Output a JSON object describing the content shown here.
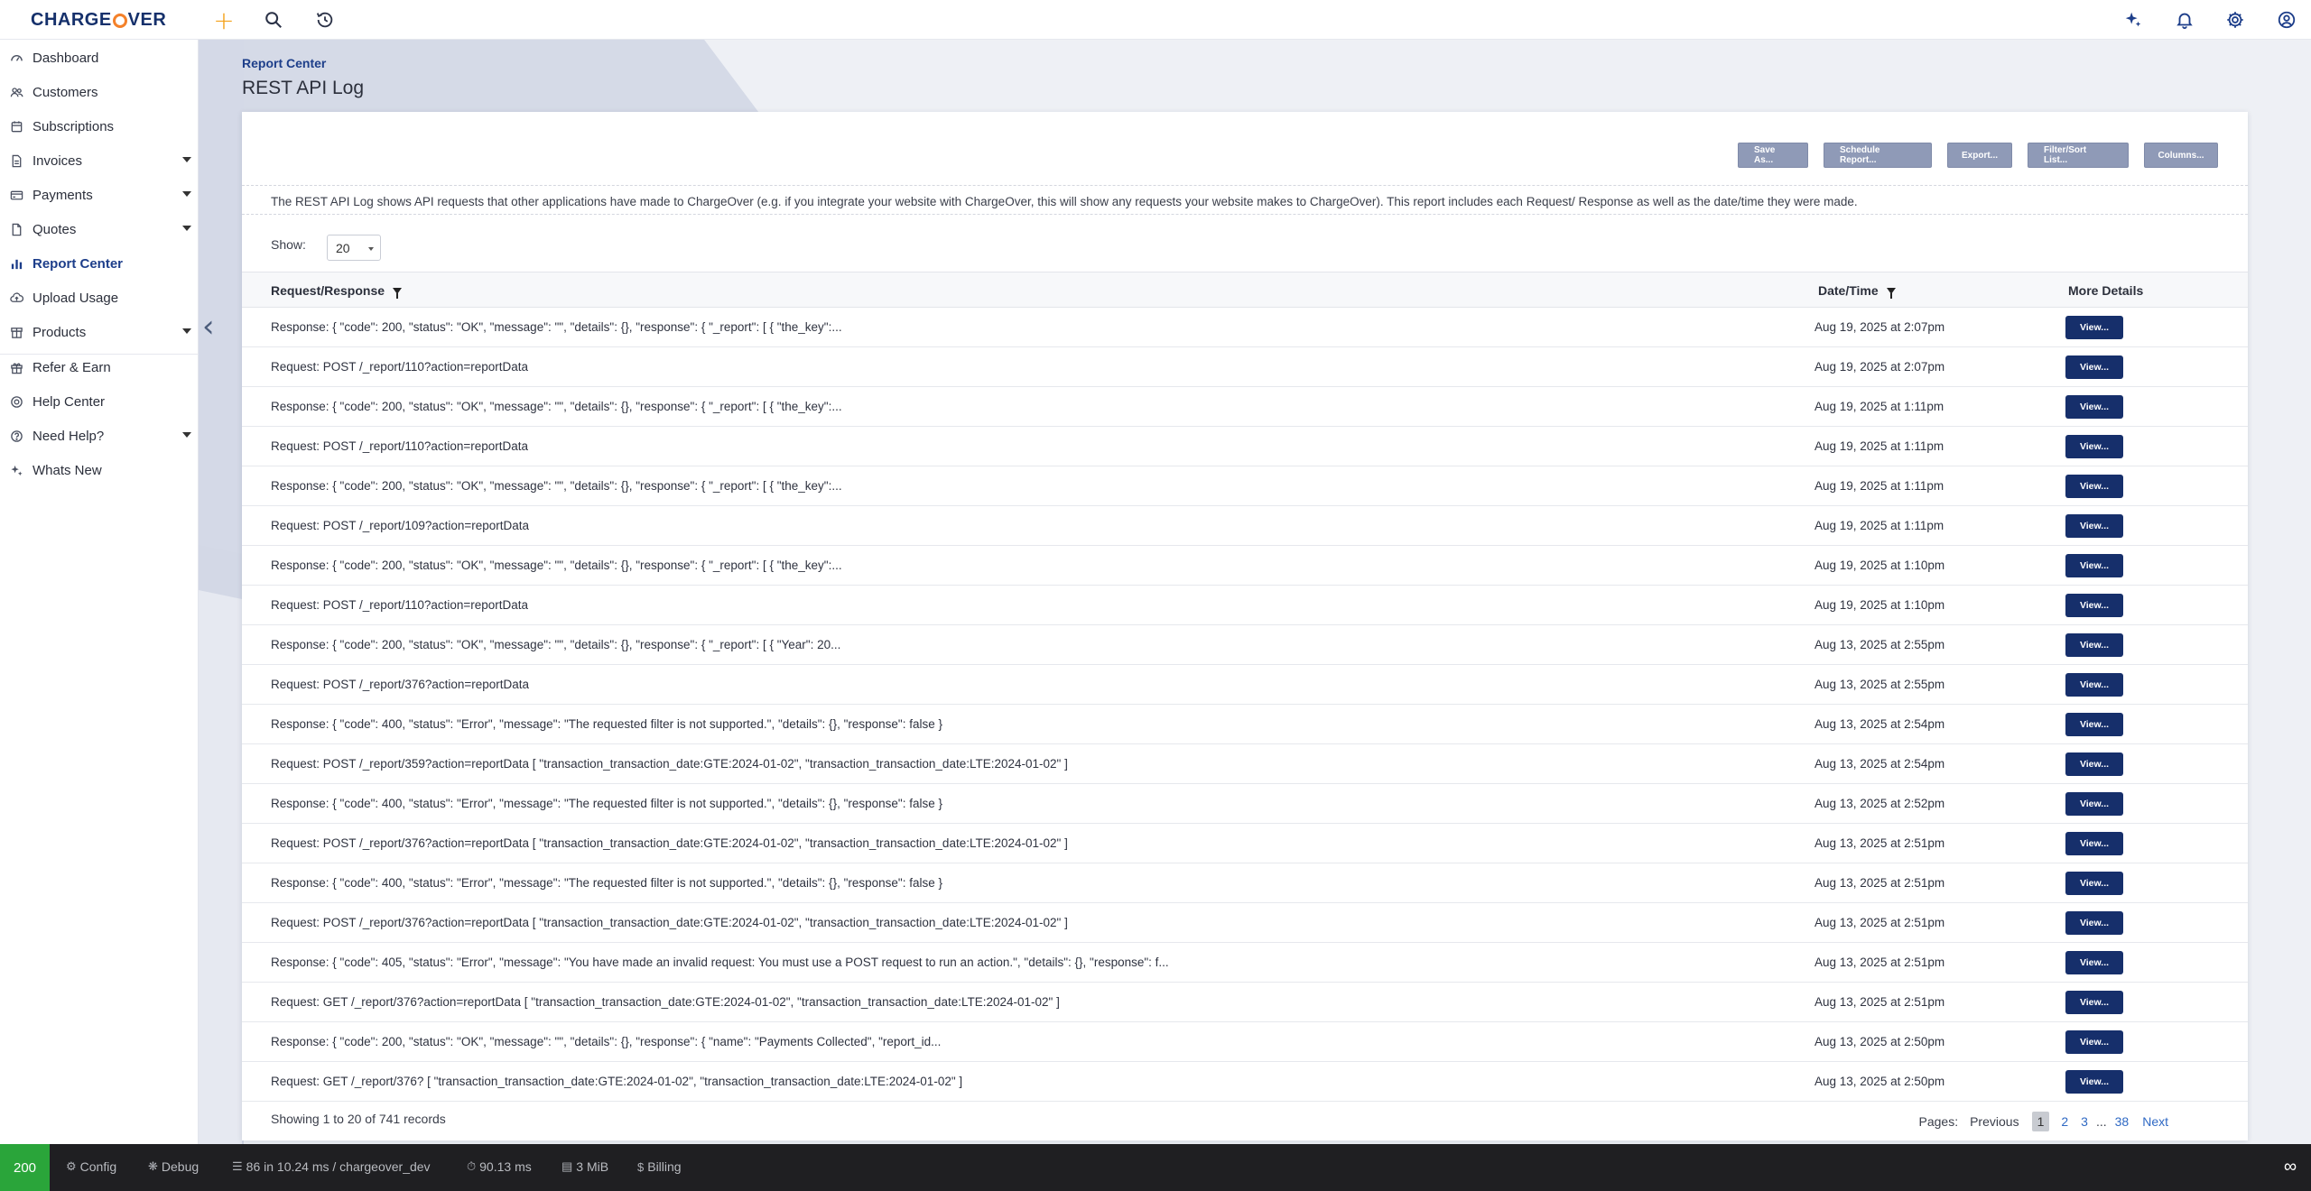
{
  "brand": {
    "prefix": "CHARGE",
    "suffix": "VER"
  },
  "nav": [
    {
      "label": "Dashboard"
    },
    {
      "label": "Customers"
    },
    {
      "label": "Subscriptions"
    },
    {
      "label": "Invoices"
    },
    {
      "label": "Payments"
    },
    {
      "label": "Quotes"
    },
    {
      "label": "Report Center"
    },
    {
      "label": "Upload Usage"
    },
    {
      "label": "Products"
    },
    {
      "label": "Refer & Earn"
    },
    {
      "label": "Help Center"
    },
    {
      "label": "Need Help?"
    },
    {
      "label": "Whats New"
    }
  ],
  "header": {
    "breadcrumb": "Report Center",
    "title": "REST API Log"
  },
  "toolbar": {
    "save_as": "Save As...",
    "schedule": "Schedule Report...",
    "export": "Export...",
    "filter_sort": "Filter/Sort List...",
    "columns": "Columns..."
  },
  "description": "The REST API Log shows API requests that other applications have made to ChargeOver (e.g. if you integrate your website with ChargeOver, this will show any requests your website makes to ChargeOver). This report includes each Request/ Response as well as the date/time they were made.",
  "show": {
    "label": "Show:",
    "value": "20"
  },
  "table": {
    "headers": {
      "request": "Request/Response",
      "date": "Date/Time",
      "more": "More Details"
    },
    "view_label": "View...",
    "rows": [
      {
        "req": "Response: { \"code\": 200, \"status\": \"OK\", \"message\": \"\", \"details\": {}, \"response\": { \"_report\": [ { \"the_key\":...",
        "date": "Aug 19, 2025 at 2:07pm"
      },
      {
        "req": "Request: POST /_report/110?action=reportData",
        "date": "Aug 19, 2025 at 2:07pm"
      },
      {
        "req": "Response: { \"code\": 200, \"status\": \"OK\", \"message\": \"\", \"details\": {}, \"response\": { \"_report\": [ { \"the_key\":...",
        "date": "Aug 19, 2025 at 1:11pm"
      },
      {
        "req": "Request: POST /_report/110?action=reportData",
        "date": "Aug 19, 2025 at 1:11pm"
      },
      {
        "req": "Response: { \"code\": 200, \"status\": \"OK\", \"message\": \"\", \"details\": {}, \"response\": { \"_report\": [ { \"the_key\":...",
        "date": "Aug 19, 2025 at 1:11pm"
      },
      {
        "req": "Request: POST /_report/109?action=reportData",
        "date": "Aug 19, 2025 at 1:11pm"
      },
      {
        "req": "Response: { \"code\": 200, \"status\": \"OK\", \"message\": \"\", \"details\": {}, \"response\": { \"_report\": [ { \"the_key\":...",
        "date": "Aug 19, 2025 at 1:10pm"
      },
      {
        "req": "Request: POST /_report/110?action=reportData",
        "date": "Aug 19, 2025 at 1:10pm"
      },
      {
        "req": "Response: { \"code\": 200, \"status\": \"OK\", \"message\": \"\", \"details\": {}, \"response\": { \"_report\": [ { \"Year\": 20...",
        "date": "Aug 13, 2025 at 2:55pm"
      },
      {
        "req": "Request: POST /_report/376?action=reportData",
        "date": "Aug 13, 2025 at 2:55pm"
      },
      {
        "req": "Response: { \"code\": 400, \"status\": \"Error\", \"message\": \"The requested filter is not supported.\", \"details\": {}, \"response\": false }",
        "date": "Aug 13, 2025 at 2:54pm"
      },
      {
        "req": "Request: POST /_report/359?action=reportData [ \"transaction_transaction_date:GTE:2024-01-02\", \"transaction_transaction_date:LTE:2024-01-02\" ]",
        "date": "Aug 13, 2025 at 2:54pm"
      },
      {
        "req": "Response: { \"code\": 400, \"status\": \"Error\", \"message\": \"The requested filter is not supported.\", \"details\": {}, \"response\": false }",
        "date": "Aug 13, 2025 at 2:52pm"
      },
      {
        "req": "Request: POST /_report/376?action=reportData [ \"transaction_transaction_date:GTE:2024-01-02\", \"transaction_transaction_date:LTE:2024-01-02\" ]",
        "date": "Aug 13, 2025 at 2:51pm"
      },
      {
        "req": "Response: { \"code\": 400, \"status\": \"Error\", \"message\": \"The requested filter is not supported.\", \"details\": {}, \"response\": false }",
        "date": "Aug 13, 2025 at 2:51pm"
      },
      {
        "req": "Request: POST /_report/376?action=reportData [ \"transaction_transaction_date:GTE:2024-01-02\", \"transaction_transaction_date:LTE:2024-01-02\" ]",
        "date": "Aug 13, 2025 at 2:51pm"
      },
      {
        "req": "Response: { \"code\": 405, \"status\": \"Error\", \"message\": \"You have made an invalid request: You must use a POST request to run an action.\", \"details\": {}, \"response\": f...",
        "date": "Aug 13, 2025 at 2:51pm"
      },
      {
        "req": "Request: GET /_report/376?action=reportData [ \"transaction_transaction_date:GTE:2024-01-02\", \"transaction_transaction_date:LTE:2024-01-02\" ]",
        "date": "Aug 13, 2025 at 2:51pm"
      },
      {
        "req": "Response: { \"code\": 200, \"status\": \"OK\", \"message\": \"\", \"details\": {}, \"response\": { \"name\": \"Payments Collected\", \"report_id...",
        "date": "Aug 13, 2025 at 2:50pm"
      },
      {
        "req": "Request: GET /_report/376? [ \"transaction_transaction_date:GTE:2024-01-02\", \"transaction_transaction_date:LTE:2024-01-02\" ]",
        "date": "Aug 13, 2025 at 2:50pm"
      }
    ]
  },
  "summary": "Showing 1 to 20 of 741 records",
  "pagination": {
    "label": "Pages:",
    "previous": "Previous",
    "pages": [
      "1",
      "2",
      "3"
    ],
    "ellipsis": "...",
    "last": "38",
    "next": "Next",
    "current": "1"
  },
  "debugbar": {
    "status": "200",
    "config": "Config",
    "debug": "Debug",
    "queries": "86 in 10.24 ms / chargeover_dev",
    "time": "90.13 ms",
    "memory": "3 MiB",
    "billing": "Billing"
  },
  "colors": {
    "brand_navy": "#15306b",
    "brand_orange": "#f4812a",
    "button_navy": "#162f6b",
    "toolbar_button": "#8f9ab7",
    "status_ok": "#2aa53a"
  }
}
